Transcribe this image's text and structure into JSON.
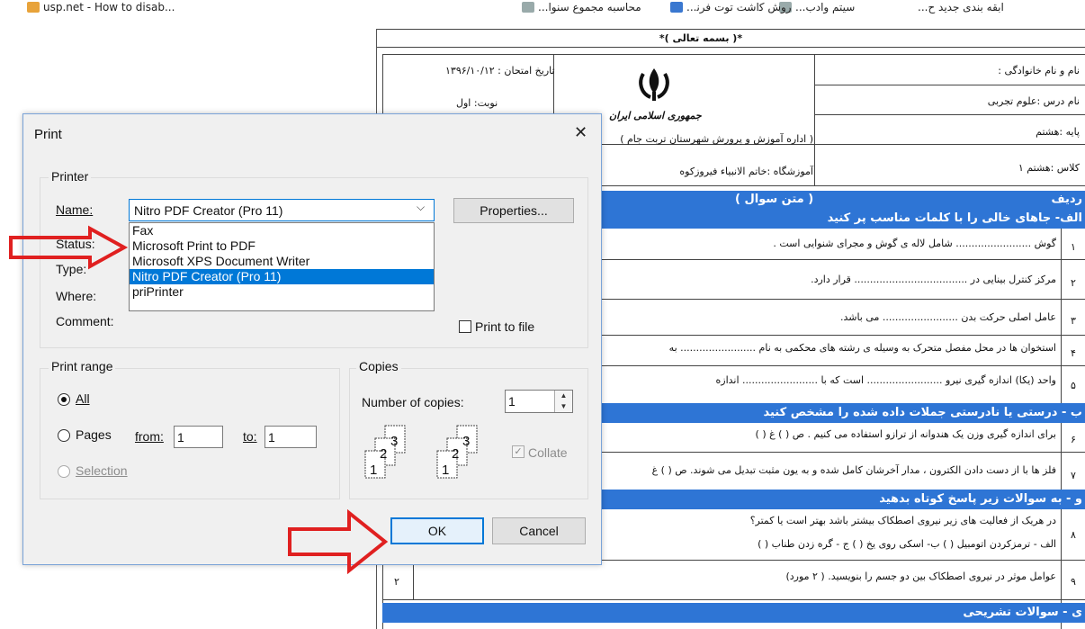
{
  "bookmarks": [
    {
      "label": "...ابقه بندی جدید ح"
    },
    {
      "label": "...ﺳﯿﺘﻢ وادب"
    },
    {
      "label": "...روش ﮐاشت توت فرﻧ"
    },
    {
      "label": "...محاسبه مجموع سنوا"
    },
    {
      "label": "usp.net - How to disab..."
    }
  ],
  "document": {
    "heading": "*( بسمه تعالی )*",
    "header_right": [
      "نام و نام خانوادگی :",
      "نام درس :علوم تجربی",
      "پایه :هشتم",
      "کلاس :هشتم ۱"
    ],
    "header_left": [
      "تاریخ امتحان : ۱۳۹۶/۱۰/۱۲",
      "نوبت: اول"
    ],
    "emblem_caption": "جمهوری اسلامی ایران",
    "office": "( اداره آموزش و پرورش شهرستان تربت جام )",
    "school": "آموزشگاه :خاتم الانبیاء فیروزکوه",
    "col_row": "ردیف",
    "col_text": "( متن سوال )",
    "sections": [
      {
        "title": "الف- جاهای خالی را با کلمات مناسب پر کنید"
      },
      {
        "title": "ب - درستی یا نادرستی جملات داده شده را مشخص کنید"
      },
      {
        "title": "و - به سوالات زیر پاسخ کوتاه بدهید"
      },
      {
        "title": "ی - سوالات تشریحی"
      }
    ],
    "questions": [
      {
        "num": "۱",
        "text": "گوش ........................ شامل لاله ی گوش و مجرای شنوایی است ."
      },
      {
        "num": "۲",
        "text": "مرکز کنترل بینایی در .................................... قرار دارد."
      },
      {
        "num": "۳",
        "text": "عامل اصلی حرکت بدن ........................ می باشد."
      },
      {
        "num": "۴",
        "text": "استخوان ها در محل مفصل متحرک به وسیله ی رشته های محکمی به نام ........................ به"
      },
      {
        "num": "۵",
        "text": "واحد (یکا) اندازه گیری نیرو ........................ است که با ........................ اندازه"
      },
      {
        "num": "۶",
        "text": "برای اندازه گیری وزن یک هندوانه از ترازو استفاده می کنیم . ص (   ) غ (   )"
      },
      {
        "num": "۷",
        "text": "فلز ها با از دست دادن الکترون ، مدار آخرشان کامل شده و به یون مثبت تبدیل می شوند.  ص (   ) غ"
      },
      {
        "num": "۸",
        "text": "در هریک از فعالیت های زیر نیروی اصطکاک بیشتر باشد بهتر است یا کمتر؟",
        "text2": "الف - ترمزکردن اتومبیل (       ) ب- اسکی روی یخ (       ) ج - گره زدن طناب (       )"
      },
      {
        "num": "۹",
        "text": "عوامل موثر در نیروی اصطکاک بین دو جسم را بنویسید. ( ۲ مورد)",
        "score": "۲"
      }
    ]
  },
  "dialog": {
    "title": "Print",
    "printer_group": "Printer",
    "name_label": "Name:",
    "status_label": "Status:",
    "type_label": "Type:",
    "where_label": "Where:",
    "comment_label": "Comment:",
    "selected_printer": "Nitro PDF Creator (Pro 11)",
    "printer_options": [
      "Fax",
      "Microsoft Print to PDF",
      "Microsoft XPS Document Writer",
      "Nitro PDF Creator (Pro 11)",
      "priPrinter"
    ],
    "properties_label": "Properties...",
    "print_to_file_label": "Print to file",
    "print_range_group": "Print range",
    "all_label": "All",
    "pages_label": "Pages",
    "from_label": "from:",
    "from_value": "1",
    "to_label": "to:",
    "to_value": "1",
    "selection_label": "Selection",
    "copies_group": "Copies",
    "num_copies_label": "Number of copies:",
    "num_copies_value": "1",
    "collate_label": "Collate",
    "collate_digits": [
      "1",
      "2",
      "3"
    ],
    "ok_label": "OK",
    "cancel_label": "Cancel"
  },
  "colors": {
    "accent": "#0078d7",
    "section_bar": "#2e75d5",
    "arrow": "#e02020"
  }
}
